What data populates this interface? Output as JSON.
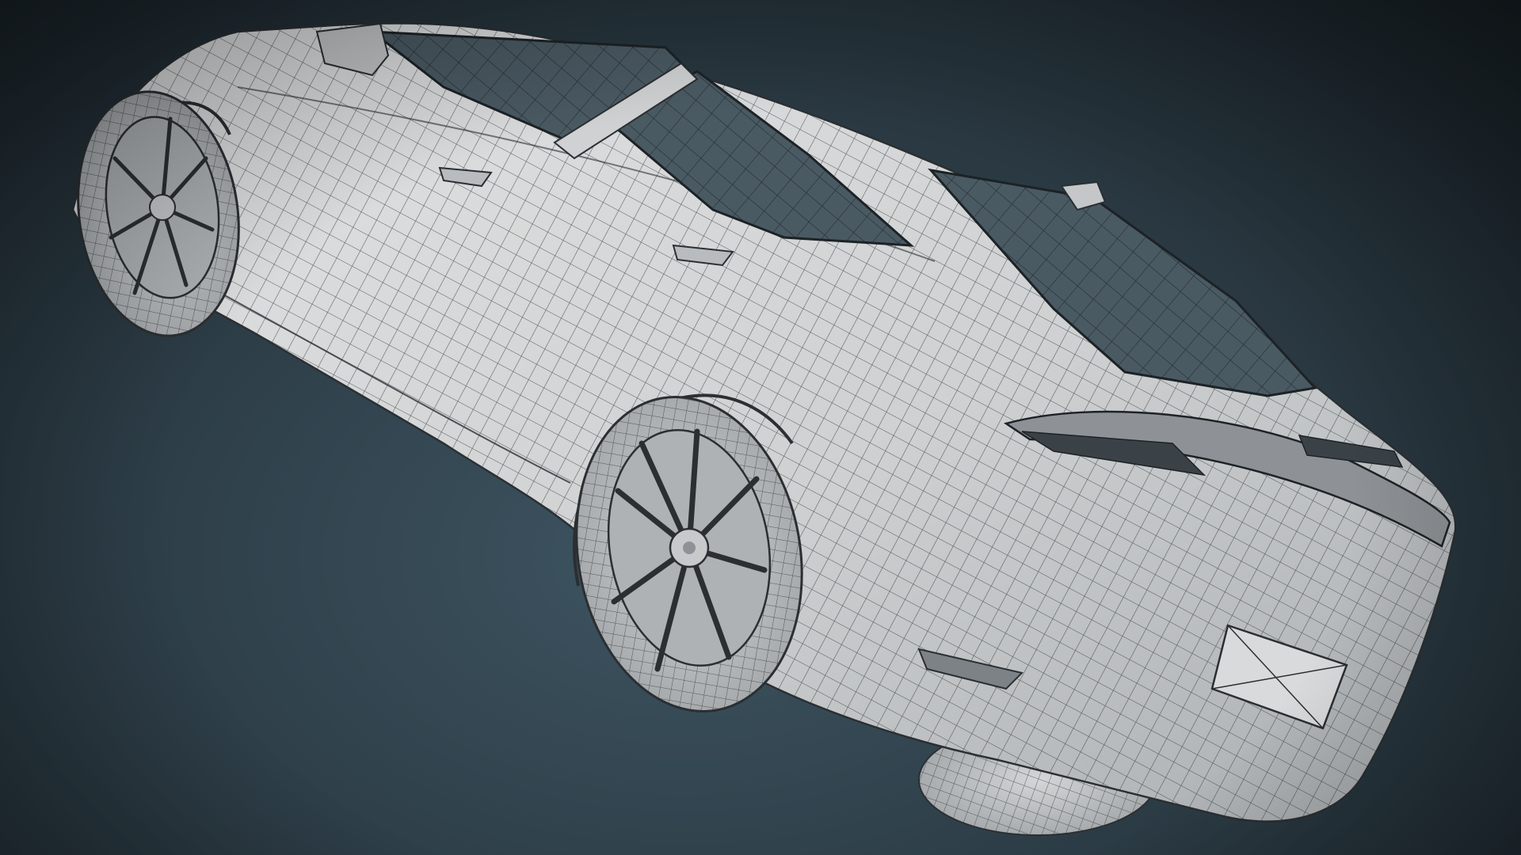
{
  "scene": {
    "subject": "car-wireframe-model",
    "colors": {
      "background_center": "#3e5562",
      "background_edge": "#1a2329",
      "body_fill": "#cfd1d2",
      "body_shadow": "#9a9ea1",
      "wire_color": "#2b2f32",
      "glass_fill": "#4a5a63",
      "tire_fill": "#bfc2c4",
      "rim_fill": "#aeb2b5"
    }
  }
}
